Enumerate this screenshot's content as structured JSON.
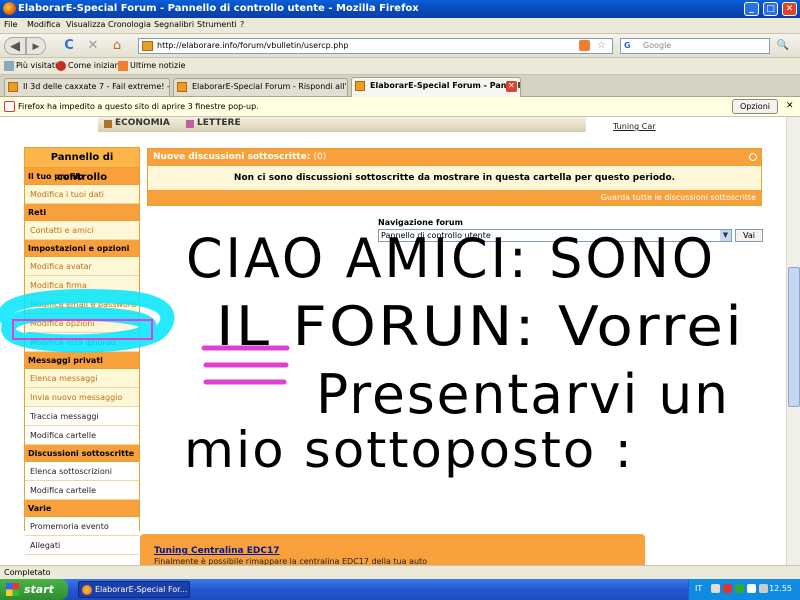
{
  "window": {
    "title": "ElaborarE-Special Forum - Pannello di controllo utente - Mozilla Firefox",
    "minimize_glyph": "_",
    "maximize_glyph": "□",
    "close_glyph": "✕"
  },
  "menu": [
    "File",
    "Modifica",
    "Visualizza",
    "Cronologia",
    "Segnalibri",
    "Strumenti",
    "?"
  ],
  "navbar": {
    "back_glyph": "◀",
    "forward_glyph": "▶",
    "reload_glyph": "C",
    "stop_glyph": "✕",
    "home_glyph": "⌂",
    "url": "http://elaborare.info/forum/vbulletin/usercp.php",
    "search_placeholder": "Google",
    "search_engine_glyph": "G",
    "magnifier_glyph": "🔍"
  },
  "bookmarks": [
    "Più visitati",
    "Come iniziare",
    "Ultime notizie"
  ],
  "tabs": [
    {
      "label": "Il 3d delle caxxate 7 - Fail extreme! - P..."
    },
    {
      "label": "ElaborarE-Special Forum - Rispondi all'a..."
    },
    {
      "label": "ElaborarE-Special Forum - Pannel..."
    }
  ],
  "popup_notice": {
    "text": "Firefox ha impedito a questo sito di aprire 3 finestre pop-up.",
    "options_label": "Opzioni",
    "close_glyph": "✕"
  },
  "top_banner": {
    "cat1": "ECONOMIA",
    "cat2": "LETTERE",
    "link": "Tuning Car"
  },
  "sidebar": {
    "title": "Pannello di controllo",
    "sections": [
      {
        "heading": "Il tuo profilo",
        "items": [
          "Modifica i tuoi dati"
        ]
      },
      {
        "heading": "Reti",
        "items": [
          "Contatti e amici"
        ]
      },
      {
        "heading": "Impostazioni e opzioni",
        "items": [
          "Modifica avatar",
          "Modifica firma",
          "Modifica email e password",
          "Modifica opzioni",
          "Modifica lista ignorati"
        ]
      },
      {
        "heading": "Messaggi privati",
        "items": [
          "Elenca messaggi",
          "Invia nuovo messaggio",
          "Traccia messaggi",
          "Modifica cartelle"
        ]
      },
      {
        "heading": "Discussioni sottoscritte",
        "items": [
          "Elenca sottoscrizioni",
          "Modifica cartelle"
        ]
      },
      {
        "heading": "Varie",
        "items": [
          "Promemoria evento",
          "Allegati"
        ]
      }
    ]
  },
  "subscribed_panel": {
    "header": "Nuove discussioni sottoscritte:",
    "count": "(0)",
    "message": "Non ci sono discussioni sottoscritte da mostrare in questa cartella per questo periodo.",
    "footer_link": "Guarda tutte le discussioni sottoscritte"
  },
  "forum_nav": {
    "label": "Navigazione forum",
    "selected": "Pannello di controllo utente",
    "go_label": "Vai"
  },
  "ad": {
    "title": "Tuning Centralina EDC17",
    "text": "Finalmente è possibile rimappare la centralina EDC17 della tua auto"
  },
  "handwriting": {
    "line1": "CIAO AMICI: SONO",
    "line2": "IL FORUN: Vorrei",
    "line3": "Presentarvi un",
    "line4": "mio sottoposto :",
    "ink_color": "#000000",
    "highlight_color": "#00e5ff",
    "marker_color": "#e040d0"
  },
  "status": "Completato",
  "taskbar": {
    "start_label": "start",
    "item": "ElaborarE-Special For...",
    "lang": "IT",
    "clock": "12.55"
  },
  "colors": {
    "accent_orange": "#f8a13c",
    "title_blue": "#0a5fd8"
  }
}
